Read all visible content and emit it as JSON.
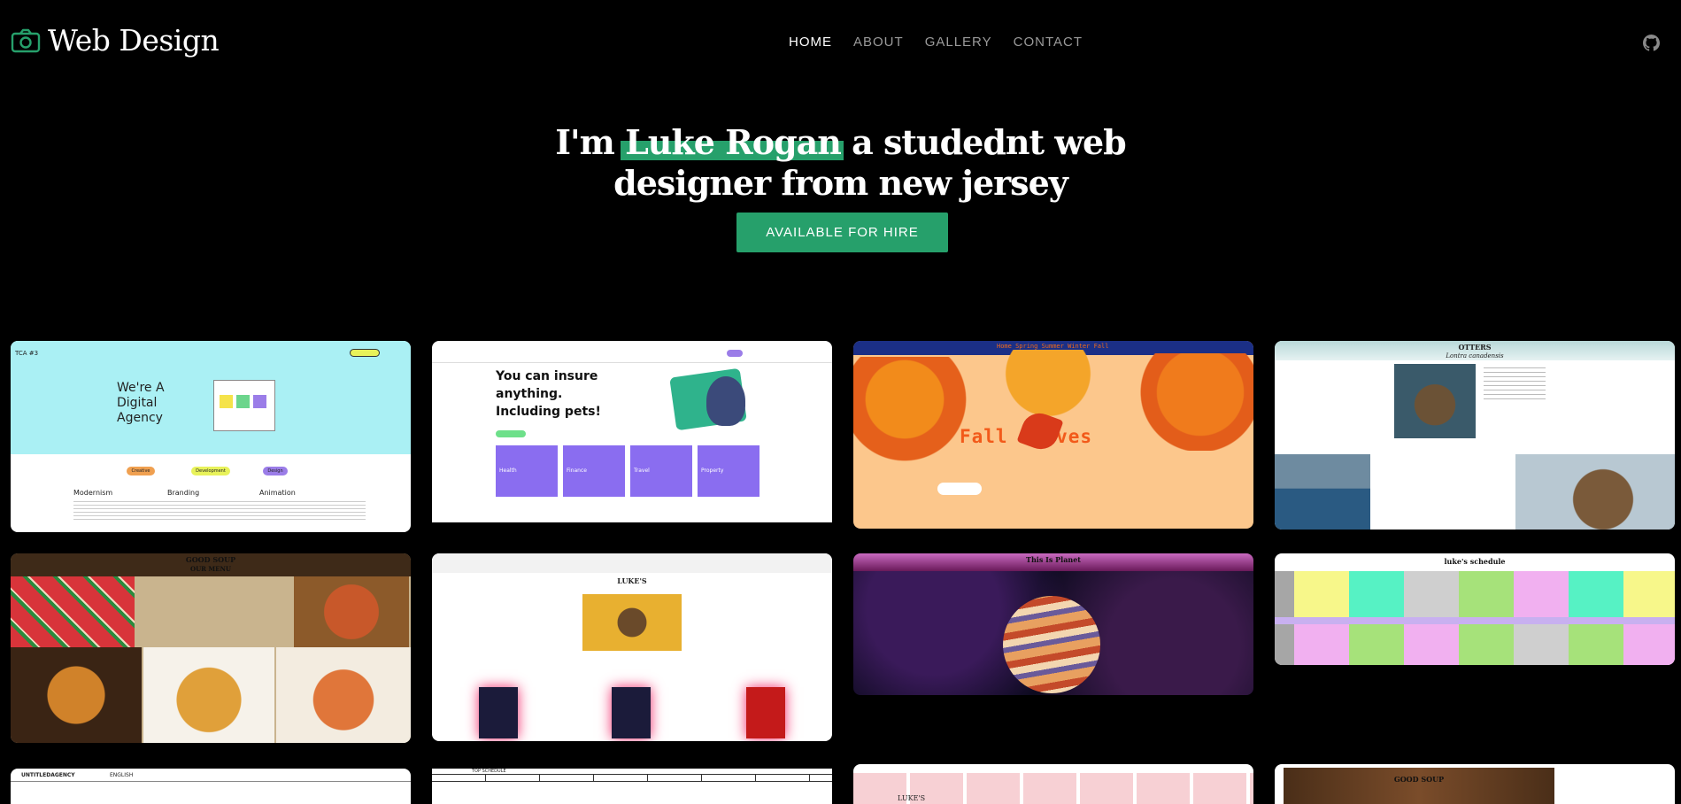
{
  "brand": {
    "name": "Web Design",
    "icon": "camera-icon",
    "accent": "#26a06b"
  },
  "nav": {
    "items": [
      {
        "label": "HOME",
        "active": true
      },
      {
        "label": "ABOUT",
        "active": false
      },
      {
        "label": "GALLERY",
        "active": false
      },
      {
        "label": "CONTACT",
        "active": false
      }
    ]
  },
  "hero": {
    "prefix": "I'm",
    "name": "Luke Rogan",
    "suffix": "a studednt web",
    "line2": "designer from new jersey",
    "cta": "AVAILABLE FOR HIRE"
  },
  "gallery": {
    "tile1": {
      "logo": "TCA #3",
      "headline": "We're A Digital Agency",
      "col1": "Modernism",
      "col2": "Branding",
      "col3": "Animation",
      "pill1": "Creative",
      "pill2": "Development",
      "pill3": "Design"
    },
    "tile2": {
      "headline": "You can insure anything. Including pets!",
      "card1": "Health",
      "card2": "Finance",
      "card3": "Travel",
      "card4": "Property"
    },
    "tile3": {
      "menu": "Home Spring Summer Winter Fall",
      "title": "Fall Leaves"
    },
    "tile4": {
      "title": "OTTERS",
      "subtitle": "Lontra canadensis"
    },
    "tile5": {
      "title": "GOOD SOUP",
      "subtitle": "OUR MENU"
    },
    "tile6": {
      "title": "LUKE'S"
    },
    "tile7": {
      "title": "This Is Planet"
    },
    "tile8": {
      "title": "luke's schedule"
    },
    "tile9": {
      "logo": "UNTITLEDAGENCY",
      "nav": "ENGLISH"
    },
    "tile10": {
      "title": "TOP SCHEDULE"
    },
    "tile11": {
      "title": "LUKE'S"
    },
    "tile12": {
      "title": "GOOD SOUP"
    }
  }
}
